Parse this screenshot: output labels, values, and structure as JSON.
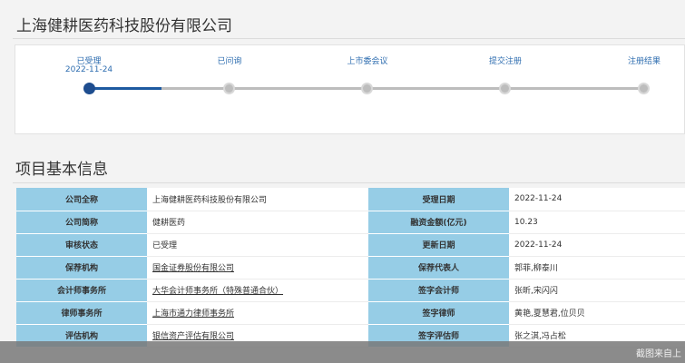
{
  "company": {
    "title": "上海健耕医药科技股份有限公司"
  },
  "progress": {
    "steps": [
      {
        "label": "已受理",
        "date": "2022-11-24",
        "active": true
      },
      {
        "label": "已问询",
        "date": "",
        "active": false
      },
      {
        "label": "上市委会议",
        "date": "",
        "active": false
      },
      {
        "label": "提交注册",
        "date": "",
        "active": false
      },
      {
        "label": "注册结果",
        "date": "",
        "active": false
      }
    ]
  },
  "section": {
    "title": "项目基本信息"
  },
  "info": {
    "rows": [
      {
        "k1": "公司全称",
        "v1": "上海健耕医药科技股份有限公司",
        "k2": "受理日期",
        "v2": "2022-11-24"
      },
      {
        "k1": "公司简称",
        "v1": "健耕医药",
        "k2": "融资金额(亿元)",
        "v2": "10.23"
      },
      {
        "k1": "审核状态",
        "v1": "已受理",
        "k2": "更新日期",
        "v2": "2022-11-24"
      },
      {
        "k1": "保荐机构",
        "v1": "国金证券股份有限公司",
        "k2": "保荐代表人",
        "v2": "郭菲,柳泰川"
      },
      {
        "k1": "会计师事务所",
        "v1": "大华会计师事务所（特殊普通合伙）",
        "k2": "签字会计师",
        "v2": "张昕,宋闪闪"
      },
      {
        "k1": "律师事务所",
        "v1": "上海市通力律师事务所",
        "k2": "签字律师",
        "v2": "黄艳,夏慧君,位贝贝"
      },
      {
        "k1": "评估机构",
        "v1": "银信资产评估有限公司",
        "k2": "签字评估师",
        "v2": "张之淇,冯占松"
      }
    ]
  },
  "footer": {
    "watermark": "截图来自上"
  },
  "colors": {
    "accent": "#1e5aa0",
    "label_bg": "#96cde6"
  }
}
